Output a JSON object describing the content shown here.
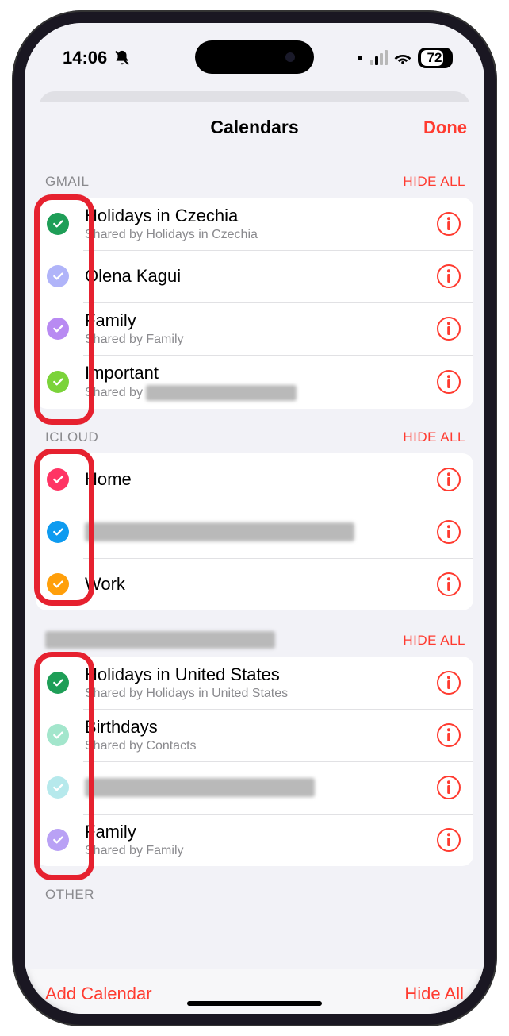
{
  "status": {
    "time": "14:06",
    "battery": "72"
  },
  "sheet": {
    "title": "Calendars",
    "done": "Done"
  },
  "sections": [
    {
      "header": "GMAIL",
      "hide": "HIDE ALL",
      "items": [
        {
          "title": "Holidays in Czechia",
          "sub": "Shared by Holidays in Czechia",
          "color": "#1e9e57"
        },
        {
          "title": "Olena Kagui",
          "sub": "",
          "color": "#b0b4f9"
        },
        {
          "title": "Family",
          "sub": "Shared by Family",
          "color": "#b88af2"
        },
        {
          "title": "Important",
          "sub": "Shared by",
          "color": "#7bd33a",
          "redacted_sub": true
        }
      ]
    },
    {
      "header": "ICLOUD",
      "hide": "HIDE ALL",
      "items": [
        {
          "title": "Home",
          "sub": "",
          "color": "#ff3464"
        },
        {
          "title": "",
          "sub": "",
          "color": "#0e9bf0",
          "redacted_title": true,
          "ellipsis": "…"
        },
        {
          "title": "Work",
          "sub": "",
          "color": "#ff9f0a"
        }
      ]
    },
    {
      "header": "",
      "hide": "HIDE ALL",
      "redacted_header": true,
      "items": [
        {
          "title": "Holidays in United States",
          "sub": "Shared by Holidays in United States",
          "color": "#1e9e57"
        },
        {
          "title": "Birthdays",
          "sub": "Shared by Contacts",
          "color": "#a3e6cc"
        },
        {
          "title": "",
          "sub": "",
          "color": "#b6e9ec",
          "redacted_title": true
        },
        {
          "title": "Family",
          "sub": "Shared by Family",
          "color": "#b9a1f5"
        }
      ]
    },
    {
      "header": "OTHER",
      "hide": "",
      "items": []
    }
  ],
  "footer": {
    "add": "Add Calendar",
    "hide_all": "Hide All"
  }
}
